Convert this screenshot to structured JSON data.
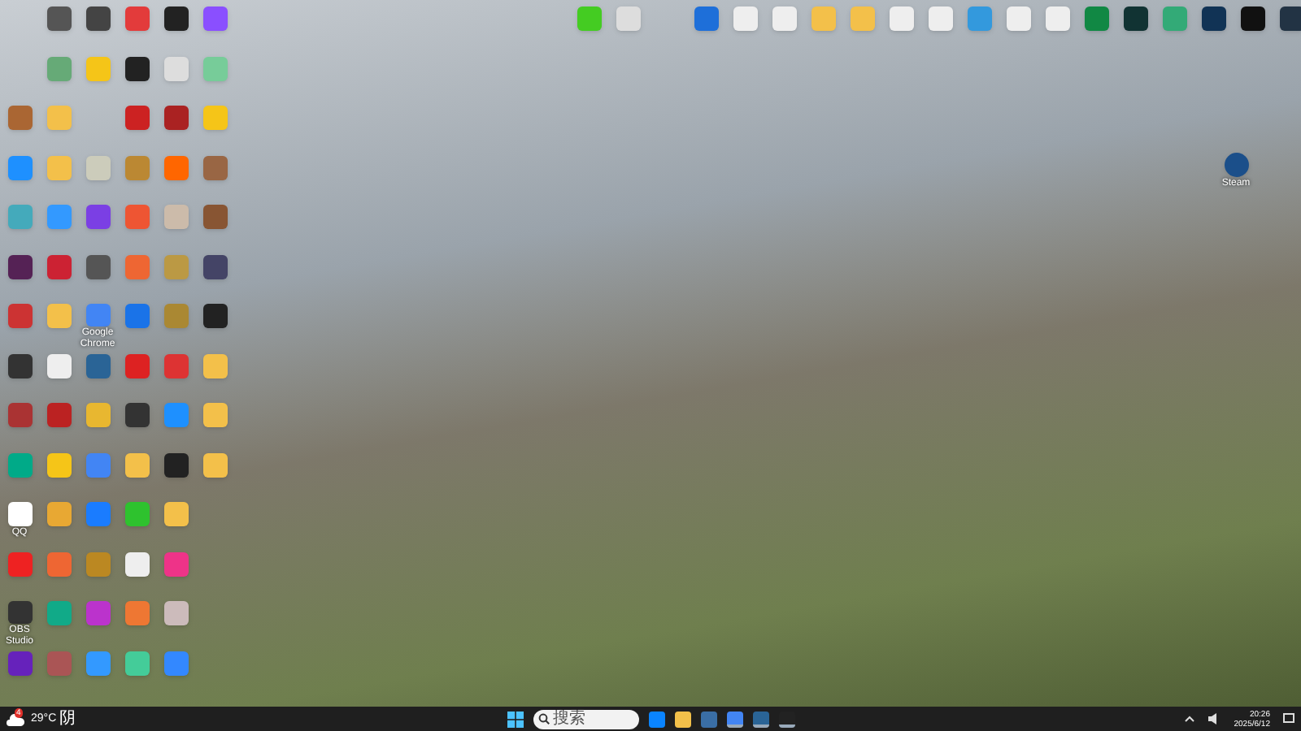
{
  "left_icons": [
    [
      {
        "kind": "gap"
      },
      {
        "color": "#555555"
      },
      {
        "color": "#444444"
      },
      {
        "color": "#e33b3b"
      },
      {
        "color": "#222222"
      },
      {
        "color": "#8a4fff"
      }
    ],
    [
      {
        "kind": "gap"
      },
      {
        "color": "#66aa77"
      },
      {
        "color": "#f5c518"
      },
      {
        "color": "#222222"
      },
      {
        "color": "#dddddd"
      },
      {
        "color": "#77cc99"
      }
    ],
    [
      {
        "color": "#aa6633"
      },
      {
        "color": "#f3c04a"
      },
      {
        "kind": "gap"
      },
      {
        "color": "#cc2222"
      },
      {
        "color": "#aa2222"
      },
      {
        "color": "#f5c518"
      }
    ],
    [
      {
        "color": "#1e90ff"
      },
      {
        "color": "#f3c04a"
      },
      {
        "color": "#ccccbb"
      },
      {
        "color": "#bb8833"
      },
      {
        "color": "#ff6600"
      },
      {
        "color": "#996644"
      }
    ],
    [
      {
        "color": "#44aabb"
      },
      {
        "color": "#3399ff"
      },
      {
        "color": "#7b3fe4"
      },
      {
        "color": "#ee5533"
      },
      {
        "color": "#ccbbaa"
      },
      {
        "color": "#885533"
      }
    ],
    [
      {
        "color": "#552255"
      },
      {
        "color": "#cc2233"
      },
      {
        "color": "#555555"
      },
      {
        "color": "#ee6633"
      },
      {
        "color": "#bb9944"
      },
      {
        "color": "#444466"
      }
    ],
    [
      {
        "color": "#cc3333"
      },
      {
        "color": "#f3c04a"
      },
      {
        "color": "#4285f4",
        "label": "Google Chrome"
      },
      {
        "color": "#1a73e8"
      },
      {
        "color": "#aa8833"
      },
      {
        "color": "#222222"
      }
    ],
    [
      {
        "color": "#333333"
      },
      {
        "color": "#eeeeee"
      },
      {
        "color": "#2a6496"
      },
      {
        "color": "#dd2222"
      },
      {
        "color": "#dd3333"
      },
      {
        "color": "#f3c04a"
      }
    ],
    [
      {
        "color": "#aa3333"
      },
      {
        "color": "#bb2222"
      },
      {
        "color": "#e8b730"
      },
      {
        "color": "#333333"
      },
      {
        "color": "#1e90ff"
      },
      {
        "color": "#f3c04a"
      }
    ],
    [
      {
        "color": "#00aa88"
      },
      {
        "color": "#f5c518"
      },
      {
        "color": "#4285f4"
      },
      {
        "color": "#f3c04a"
      },
      {
        "color": "#222222"
      },
      {
        "color": "#f3c04a"
      }
    ],
    [
      {
        "color": "#ffffff",
        "label": "QQ"
      },
      {
        "color": "#e8a833"
      },
      {
        "color": "#1a7cff"
      },
      {
        "color": "#2ec22e"
      },
      {
        "color": "#f3c04a"
      }
    ],
    [
      {
        "color": "#ee2222"
      },
      {
        "color": "#ee6633"
      },
      {
        "color": "#bb8822"
      },
      {
        "color": "#eeeeee"
      },
      {
        "color": "#ee3388"
      }
    ],
    [
      {
        "color": "#333333",
        "label": "OBS Studio"
      },
      {
        "color": "#11aa88"
      },
      {
        "color": "#bb33cc"
      },
      {
        "color": "#ee7733"
      },
      {
        "color": "#ccbbbb"
      }
    ],
    [
      {
        "color": "#6622bb"
      },
      {
        "color": "#aa5555"
      },
      {
        "color": "#3399ff"
      },
      {
        "color": "#44cc99"
      },
      {
        "color": "#3388ff"
      }
    ]
  ],
  "top_icons": [
    {
      "color": "#44cc22"
    },
    {
      "color": "#dddddd"
    },
    {
      "kind": "gap"
    },
    {
      "color": "#1e6fd9"
    },
    {
      "color": "#eeeeee"
    },
    {
      "color": "#eeeeee"
    },
    {
      "color": "#f3c04a"
    },
    {
      "color": "#f3c04a"
    },
    {
      "color": "#eeeeee"
    },
    {
      "color": "#eeeeee"
    },
    {
      "color": "#3399dd"
    },
    {
      "color": "#eeeeee"
    },
    {
      "color": "#eeeeee"
    },
    {
      "color": "#118844"
    },
    {
      "color": "#113333"
    },
    {
      "color": "#33aa77"
    },
    {
      "color": "#113355"
    },
    {
      "color": "#111111"
    },
    {
      "color": "#223344"
    }
  ],
  "steam_icon": {
    "color": "#1b4f8a",
    "label": "Steam"
  },
  "taskbar": {
    "weather": {
      "temperature": "29°C",
      "condition": "阴",
      "badge": "4"
    },
    "search": {
      "placeholder": "搜索"
    },
    "pinned": [
      {
        "color": "#0a84ff",
        "active": false
      },
      {
        "color": "#f3c04a",
        "active": false
      },
      {
        "color": "#3a6ea5",
        "active": false
      },
      {
        "color": "#4285f4",
        "active": true
      },
      {
        "color": "#2a6496",
        "active": true
      },
      {
        "color": "#222222",
        "active": true
      }
    ],
    "clock": {
      "time": "20:26",
      "date": "2025/6/12"
    }
  }
}
